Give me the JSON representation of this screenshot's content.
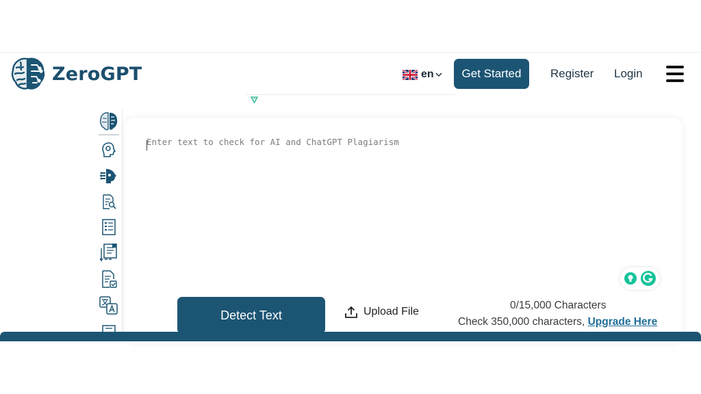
{
  "header": {
    "brand": "ZeroGPT",
    "language": "en",
    "get_started": "Get Started",
    "register": "Register",
    "login": "Login"
  },
  "rail": {
    "icons": [
      "ai-detector-brain-icon",
      "ai-humanizer-icon",
      "ai-chat-icon",
      "paraphraser-icon",
      "summarizer-icon",
      "word-counter-icon",
      "grammar-checker-icon",
      "translator-icon",
      "citation-icon"
    ]
  },
  "editor": {
    "placeholder": "Enter text to check for AI and ChatGPT Plagiarism",
    "value": ""
  },
  "actions": {
    "detect": "Detect Text",
    "upload": "Upload File"
  },
  "counter": {
    "count": "0/15,000 Characters",
    "upgrade_prefix": "Check 350,000 characters, ",
    "upgrade_link": "Upgrade Here"
  },
  "colors": {
    "brand": "#1c5574",
    "link": "#1f6e96",
    "grammarly": "#15c39a"
  }
}
